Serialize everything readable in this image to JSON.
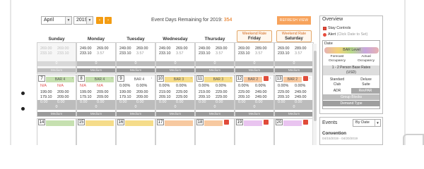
{
  "toolbar": {
    "month": "April",
    "year": "2019",
    "prev_icon": "chevron-left-icon",
    "next_icon": "chevron-right-icon",
    "remaining_label": "Event Days Remaining for 2019:",
    "remaining_value": "354",
    "refresh_label": "REFRESH VIEW"
  },
  "day_headers": [
    "Sunday",
    "Monday",
    "Tuesday",
    "Wednesday",
    "Thursday"
  ],
  "weekend_headers": [
    {
      "top": "Weekend Rate",
      "day": "Friday"
    },
    {
      "top": "Weekend Rate",
      "day": "Saturday"
    }
  ],
  "week0": {
    "sun": {
      "r1a": "269.00",
      "r1b": "269.00",
      "r2a": "233.10",
      "r2b": "233.10",
      "mid": "0",
      "med": "Medium"
    },
    "mon": {
      "r1a": "249.00",
      "r1b": "269.00",
      "r2a": "233.10",
      "r2b": "3.57"
    },
    "tue": {
      "r1a": "249.00",
      "r1b": "269.00",
      "r2a": "233.10",
      "r2b": "3.57"
    },
    "wed": {
      "r1a": "249.00",
      "r1b": "269.00",
      "r2a": "233.10",
      "r2b": "3.57"
    },
    "thu": {
      "r1a": "249.00",
      "r1b": "269.00",
      "r2a": "233.10",
      "r2b": "3.57"
    },
    "fri": {
      "r1a": "269.00",
      "r1b": "289.00",
      "r2a": "233.10",
      "r2b": "3.57"
    },
    "sat": {
      "r1a": "269.00",
      "r1b": "289.00",
      "r2a": "233.10",
      "r2b": "3.57"
    }
  },
  "week1": {
    "sun": {
      "num": "7",
      "bar": "BAR 4",
      "na1": "N/A",
      "na2": "N/A",
      "r1a": "199.00",
      "r1b": "209.00",
      "r2a": "179.10",
      "r2b": "209.00",
      "r3a": "0.00",
      "r3b": "0.00",
      "mid": "0",
      "med": "Medium"
    },
    "mon": {
      "num": "8",
      "bar": "BAR 4",
      "na1": "N/A",
      "na2": "N/A",
      "r1a": "199.00",
      "r1b": "209.00",
      "r2a": "179.10",
      "r2b": "209.00",
      "r3a": "0.00",
      "r3b": "0.00",
      "mid": "0",
      "med": "Medium"
    },
    "tue": {
      "num": "9",
      "bar": "BAR 4",
      "na1": "0.00%",
      "na2": "0.00%",
      "r1a": "199.00",
      "r1b": "209.00",
      "r2a": "179.10",
      "r2b": "209.00",
      "r3a": "0.00",
      "r3b": "0.00",
      "mid": "0",
      "med": "Medium"
    },
    "wed": {
      "num": "10",
      "bar": "BAR 3",
      "na1": "0.00%",
      "na2": "0.00%",
      "r1a": "219.00",
      "r1b": "229.00",
      "r2a": "209.10",
      "r2b": "229.00",
      "r3a": "0.00",
      "r3b": "0.00",
      "mid": "0",
      "med": "Medium"
    },
    "thu": {
      "num": "11",
      "bar": "BAR 3",
      "na1": "0.00%",
      "na2": "0.00%",
      "r1a": "219.00",
      "r1b": "229.00",
      "r2a": "209.10",
      "r2b": "229.00",
      "r3a": "0.00",
      "r3b": "0.00",
      "mid": "0",
      "med": "Medium"
    },
    "fri": {
      "num": "12",
      "bar": "BAR 2",
      "na1": "0.00%",
      "na2": "0.00%",
      "r1a": "229.00",
      "r1b": "249.00",
      "r2a": "209.10",
      "r2b": "249.00",
      "r3a": "0.00",
      "r3b": "0.00",
      "mid": "0",
      "med": "Medium"
    },
    "sat": {
      "num": "13",
      "bar": "BAR 2",
      "na1": "0.00%",
      "na2": "0.00%",
      "r1a": "229.00",
      "r1b": "249.00",
      "r2a": "209.10",
      "r2b": "249.00",
      "r3a": "0.00",
      "r3b": "0.00",
      "mid": "0",
      "med": "Medium"
    }
  },
  "week2": {
    "nums": [
      "14",
      "15",
      "16",
      "17",
      "18",
      "19",
      "20"
    ]
  },
  "overview": {
    "title": "Overview",
    "stay_controls": "Stay Controls",
    "alert": "Alert",
    "alert_sub": "(Click Date to Set)",
    "date": "Date",
    "bar_level": "BAR Level",
    "forecast": "Forecast Occupancy",
    "actual": "Actual Occupancy",
    "rates_1": "1 - 2 Person Base Rates",
    "rates_2": "(USD)",
    "standard": "Standard",
    "deluxe": "Deluxe",
    "club": "Club",
    "suite": "Suite",
    "adr": "ADR",
    "revpar": "RevPAR",
    "group_blocks": "Group Blocks",
    "demand_type": "Demand Type"
  },
  "events": {
    "title": "Events",
    "sort": "By Date",
    "name": "Convention",
    "dates": "04/15/2019 - 04/20/2019"
  }
}
